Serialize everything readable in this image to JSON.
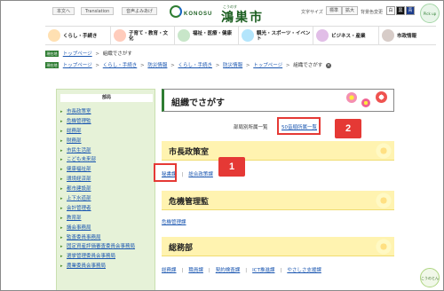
{
  "header": {
    "util_buttons": [
      "本文へ",
      "Translation",
      "音声よみあげ"
    ],
    "logo_en": "KONOSU",
    "logo_kana": "こうのす",
    "logo_jp": "鴻巣市",
    "font_size_label": "文字サイズ",
    "font_size_buttons": [
      "標準",
      "拡大"
    ],
    "contrast_label": "背景色変更",
    "contrast_buttons": [
      "白",
      "黒",
      "青"
    ],
    "pickup_label": "Pick up"
  },
  "nav": {
    "items": [
      {
        "label": "くらし・手続き",
        "icon": "family-icon"
      },
      {
        "label": "子育て・教育・文化",
        "icon": "child-icon"
      },
      {
        "label": "福祉・医療・健康",
        "icon": "health-icon"
      },
      {
        "label": "観光・スポーツ・イベント",
        "icon": "tourism-icon"
      },
      {
        "label": "ビジネス・産業",
        "icon": "business-icon"
      },
      {
        "label": "市政情報",
        "icon": "cityhall-icon"
      }
    ]
  },
  "breadcrumbs": {
    "current_tag": "現在地",
    "row1": [
      "トップページ",
      "組織でさがす"
    ],
    "row2": [
      "トップページ",
      "くらし・手続き",
      "防災情報",
      "くらし・手続き",
      "防災情報",
      "トップページ",
      "組織でさがす"
    ]
  },
  "sidebar": {
    "heading": "部局",
    "items": [
      "市長政策室",
      "危機管理監",
      "総務部",
      "財務部",
      "市民生活部",
      "こども未来部",
      "健康福祉部",
      "環境経済部",
      "都市建設部",
      "上下水道部",
      "会計管理者",
      "教育部",
      "議会事務局",
      "監査委員事務局",
      "固定資産評価審査委員会事務局",
      "選挙管理委員会事務局",
      "農業委員会事務局"
    ]
  },
  "main": {
    "title": "組織でさがす",
    "list_label": "部局別所属一覧",
    "list_link": "50音順所属一覧",
    "badge1": "1",
    "badge2": "2",
    "sections": [
      {
        "title": "市長政策室",
        "links": [
          "秘書課",
          "総合政策課"
        ]
      },
      {
        "title": "危機管理監",
        "links": [
          "危機管理課"
        ]
      },
      {
        "title": "総務部",
        "links": [
          "総務課",
          "職員課",
          "契約検査課",
          "ICT推進課",
          "やさしさ支援課"
        ]
      }
    ]
  },
  "helper_label": "こうのとん"
}
